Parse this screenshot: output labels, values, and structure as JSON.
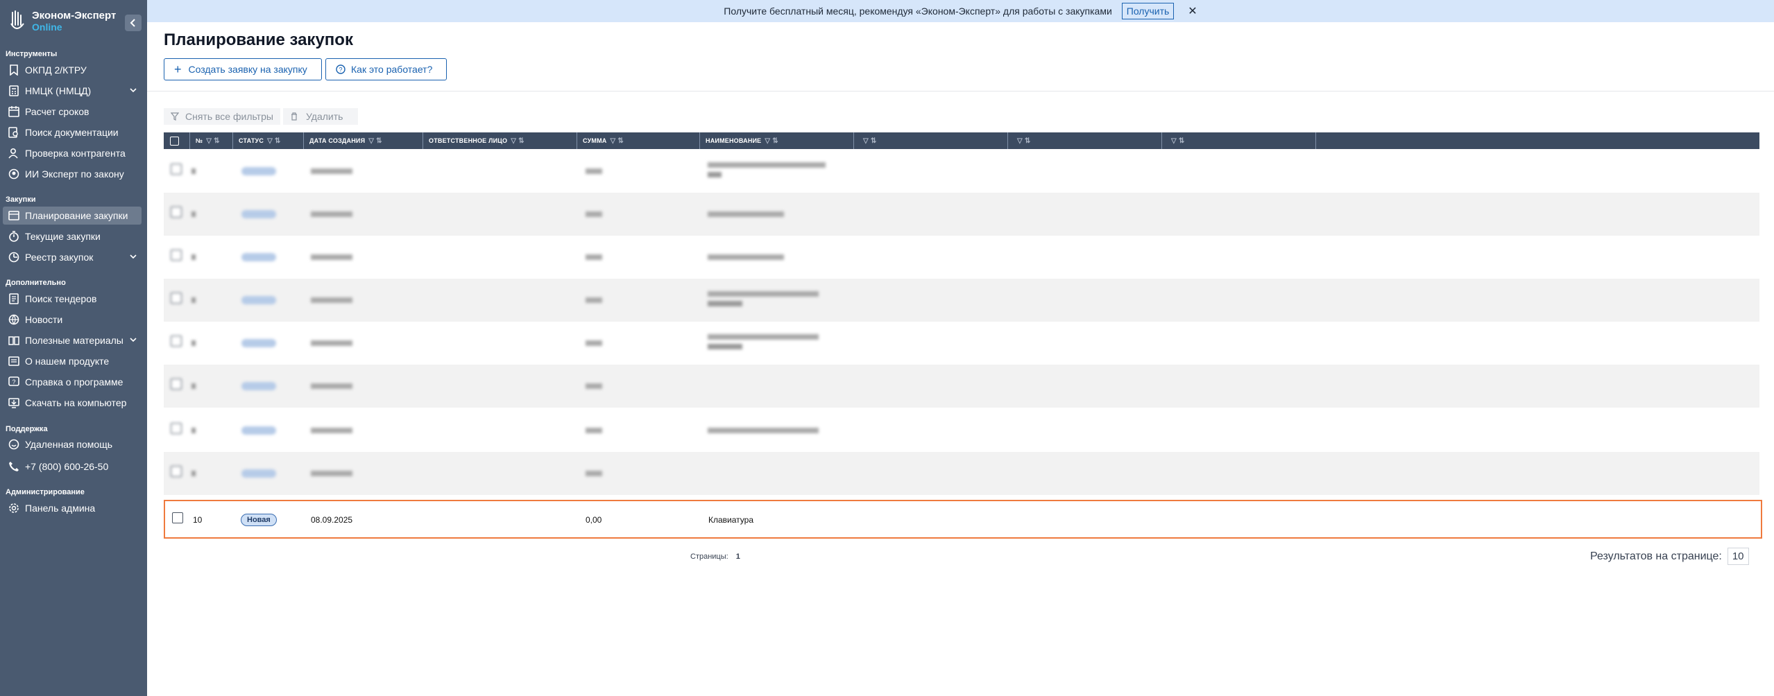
{
  "app": {
    "name": "Эконом-Эксперт",
    "sub": "Online"
  },
  "sidebar": {
    "sections": [
      {
        "title": "Инструменты",
        "items": [
          {
            "label": "ОКПД 2/КТРУ",
            "icon": "bookmark-icon"
          },
          {
            "label": "НМЦК (НМЦД)",
            "icon": "calculator-icon",
            "expandable": true
          },
          {
            "label": "Расчет сроков",
            "icon": "calendar-icon"
          },
          {
            "label": "Поиск документации",
            "icon": "file-search-icon"
          },
          {
            "label": "Проверка контрагента",
            "icon": "user-check-icon"
          },
          {
            "label": "ИИ Эксперт по закону",
            "icon": "ai-expert-icon"
          }
        ]
      },
      {
        "title": "Закупки",
        "items": [
          {
            "label": "Планирование закупки",
            "icon": "planning-icon",
            "active": true
          },
          {
            "label": "Текущие закупки",
            "icon": "timer-icon"
          },
          {
            "label": "Реестр закупок",
            "icon": "registry-icon",
            "expandable": true
          }
        ]
      },
      {
        "title": "Дополнительно",
        "items": [
          {
            "label": "Поиск тендеров",
            "icon": "document-icon"
          },
          {
            "label": "Новости",
            "icon": "globe-icon"
          },
          {
            "label": "Полезные материалы",
            "icon": "book-icon",
            "expandable": true
          },
          {
            "label": "О нашем продукте",
            "icon": "info-card-icon"
          },
          {
            "label": "Справка о программе",
            "icon": "help-icon"
          },
          {
            "label": "Скачать на компьютер",
            "icon": "download-icon"
          }
        ]
      },
      {
        "title": "Поддержка",
        "items": [
          {
            "label": "Удаленная помощь",
            "icon": "support-icon"
          },
          {
            "label": "+7 (800) 600-26-50",
            "icon": "phone-icon"
          }
        ]
      },
      {
        "title": "Администрирование",
        "items": [
          {
            "label": "Панель админа",
            "icon": "gear-icon"
          }
        ]
      }
    ]
  },
  "banner": {
    "text": "Получите бесплатный месяц, рекомендуя «Эконом-Эксперт» для работы с закупками",
    "button": "Получить"
  },
  "page": {
    "title": "Планирование закупок",
    "create_button": "Создать заявку на закупку",
    "how_button": "Как это работает?",
    "clear_filters": "Снять все фильтры",
    "delete": "Удалить"
  },
  "table": {
    "columns": [
      "№",
      "СТАТУС",
      "ДАТА СОЗДАНИЯ",
      "ОТВЕТСТВЕННОЕ ЛИЦО",
      "СУММА",
      "НАИМЕНОВАНИЕ",
      "",
      "",
      ""
    ],
    "selected_row": {
      "num": "10",
      "status": "Новая",
      "date": "08.09.2025",
      "sum": "0,00",
      "name": "Клавиатура"
    }
  },
  "pagination": {
    "label": "Страницы:",
    "page": "1",
    "per_page_label": "Результатов на странице:",
    "per_page": "10"
  },
  "colors": {
    "sidebar": "#4a5a70",
    "accent": "#1a62b0",
    "highlight": "#ef7a3e",
    "header": "#3c4b61"
  }
}
